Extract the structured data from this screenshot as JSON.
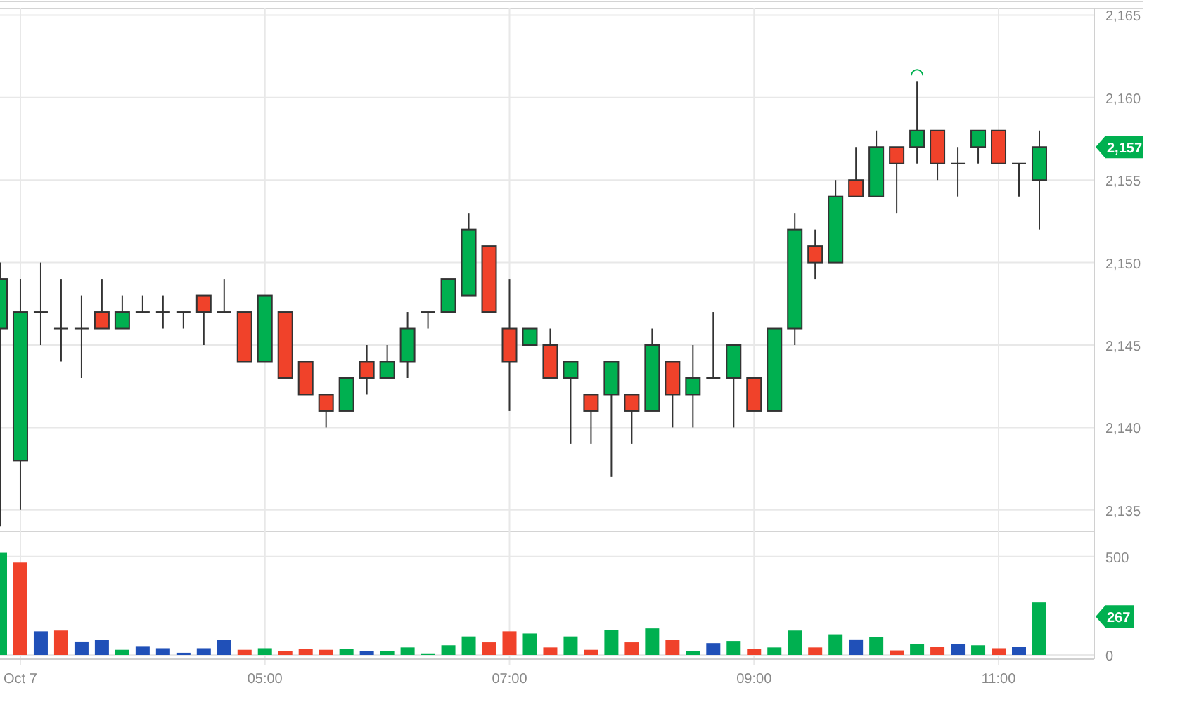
{
  "price_chart": {
    "last_price_tag": "2,157",
    "chart_data": {
      "type": "candlestick",
      "grid": true,
      "ohlc": [
        [
          2146,
          2150,
          2134,
          2149
        ],
        [
          2138,
          2149,
          2135,
          2147
        ],
        [
          2147,
          2150,
          2145,
          2147
        ],
        [
          2146,
          2149,
          2144,
          2146
        ],
        [
          2146,
          2148,
          2143,
          2146
        ],
        [
          2147,
          2149,
          2146,
          2146
        ],
        [
          2146,
          2148,
          2146,
          2147
        ],
        [
          2147,
          2148,
          2147,
          2147
        ],
        [
          2147,
          2148,
          2146,
          2147
        ],
        [
          2147,
          2147,
          2146,
          2147
        ],
        [
          2148,
          2148,
          2145,
          2147
        ],
        [
          2147,
          2149,
          2147,
          2147
        ],
        [
          2147,
          2147,
          2144,
          2144
        ],
        [
          2144,
          2148,
          2144,
          2148
        ],
        [
          2147,
          2147,
          2143,
          2143
        ],
        [
          2144,
          2144,
          2142,
          2142
        ],
        [
          2142,
          2142,
          2140,
          2141
        ],
        [
          2141,
          2143,
          2141,
          2143
        ],
        [
          2144,
          2145,
          2142,
          2143
        ],
        [
          2143,
          2145,
          2143,
          2144
        ],
        [
          2144,
          2147,
          2143,
          2146
        ],
        [
          2147,
          2147,
          2146,
          2147
        ],
        [
          2147,
          2149,
          2147,
          2149
        ],
        [
          2148,
          2153,
          2148,
          2152
        ],
        [
          2151,
          2151,
          2147,
          2147
        ],
        [
          2146,
          2149,
          2141,
          2144
        ],
        [
          2145,
          2146,
          2145,
          2146
        ],
        [
          2145,
          2146,
          2143,
          2143
        ],
        [
          2143,
          2144,
          2139,
          2144
        ],
        [
          2142,
          2142,
          2139,
          2141
        ],
        [
          2142,
          2144,
          2137,
          2144
        ],
        [
          2142,
          2142,
          2139,
          2141
        ],
        [
          2141,
          2146,
          2141,
          2145
        ],
        [
          2144,
          2144,
          2140,
          2142
        ],
        [
          2142,
          2145,
          2140,
          2143
        ],
        [
          2143,
          2147,
          2143,
          2143
        ],
        [
          2143,
          2145,
          2140,
          2145
        ],
        [
          2143,
          2143,
          2141,
          2141
        ],
        [
          2141,
          2146,
          2141,
          2146
        ],
        [
          2146,
          2153,
          2145,
          2152
        ],
        [
          2151,
          2152,
          2149,
          2150
        ],
        [
          2150,
          2155,
          2150,
          2154
        ],
        [
          2155,
          2157,
          2154,
          2154
        ],
        [
          2154,
          2158,
          2154,
          2157
        ],
        [
          2157,
          2157,
          2153,
          2156
        ],
        [
          2157,
          2161,
          2156,
          2158
        ],
        [
          2158,
          2158,
          2155,
          2156
        ],
        [
          2156,
          2157,
          2154,
          2156
        ],
        [
          2157,
          2158,
          2156,
          2158
        ],
        [
          2158,
          2158,
          2156,
          2156
        ],
        [
          2156,
          2156,
          2154,
          2156
        ],
        [
          2155,
          2158,
          2152,
          2157
        ]
      ],
      "ylim": [
        2133.8,
        2165.4
      ],
      "yticks": [
        {
          "value": 2135,
          "label": "2,135"
        },
        {
          "value": 2140,
          "label": "2,140"
        },
        {
          "value": 2145,
          "label": "2,145"
        },
        {
          "value": 2150,
          "label": "2,150"
        },
        {
          "value": 2155,
          "label": "2,155"
        },
        {
          "value": 2160,
          "label": "2,160"
        },
        {
          "value": 2165,
          "label": "2,165"
        }
      ]
    }
  },
  "volume_chart": {
    "last_volume_tag": "267",
    "chart_data": {
      "type": "bar",
      "grid": true,
      "categories": [
        null,
        "Oct 7",
        null,
        null,
        null,
        null,
        null,
        null,
        null,
        null,
        null,
        null,
        null,
        "05:00",
        null,
        null,
        null,
        null,
        null,
        null,
        null,
        null,
        null,
        null,
        null,
        "07:00",
        null,
        null,
        null,
        null,
        null,
        null,
        null,
        null,
        null,
        null,
        null,
        "09:00",
        null,
        null,
        null,
        null,
        null,
        null,
        null,
        null,
        null,
        null,
        null,
        "11:00",
        null,
        null
      ],
      "series": [
        {
          "color": "#00b050",
          "values": [
            519,
            null,
            null,
            null,
            null,
            null,
            26,
            null,
            null,
            null,
            null,
            null,
            null,
            34,
            null,
            null,
            null,
            30,
            null,
            19,
            38,
            8,
            49,
            94,
            null,
            null,
            109,
            null,
            94,
            null,
            128,
            null,
            135,
            null,
            19,
            null,
            71,
            null,
            38,
            124,
            null,
            105,
            null,
            90,
            null,
            56,
            null,
            null,
            49,
            null,
            null,
            267
          ]
        },
        {
          "color": "#f0422a",
          "values": [
            null,
            470,
            null,
            124,
            null,
            null,
            null,
            null,
            null,
            null,
            null,
            null,
            26,
            null,
            19,
            30,
            26,
            null,
            null,
            null,
            null,
            null,
            null,
            null,
            64,
            120,
            null,
            38,
            null,
            26,
            null,
            64,
            null,
            75,
            null,
            null,
            null,
            30,
            null,
            null,
            38,
            null,
            null,
            null,
            23,
            null,
            41,
            null,
            null,
            34,
            null,
            null
          ]
        },
        {
          "color": "#2050b8",
          "values": [
            null,
            null,
            120,
            null,
            68,
            75,
            null,
            45,
            34,
            11,
            34,
            75,
            null,
            null,
            null,
            null,
            null,
            null,
            19,
            null,
            null,
            null,
            null,
            null,
            null,
            null,
            null,
            null,
            null,
            null,
            null,
            null,
            null,
            null,
            null,
            60,
            null,
            null,
            null,
            null,
            null,
            null,
            79,
            null,
            null,
            null,
            null,
            56,
            null,
            null,
            41,
            null
          ]
        }
      ],
      "ylim": [
        0,
        628
      ],
      "yticks": [
        {
          "value": 0,
          "label": "0"
        },
        {
          "value": 500,
          "label": "500"
        }
      ]
    }
  }
}
